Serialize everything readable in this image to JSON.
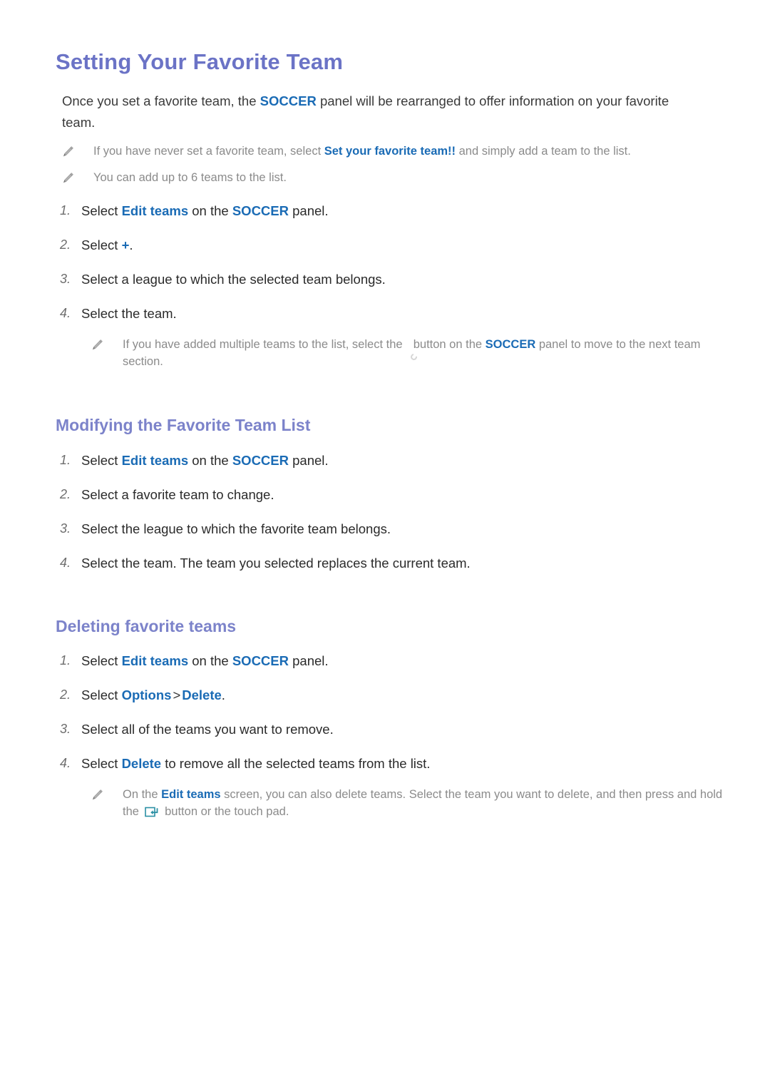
{
  "document": {
    "title": "Setting Your Favorite Team",
    "intro": {
      "before": "Once you set a favorite team, the ",
      "keyword": "SOCCER",
      "after": " panel will be rearranged to offer information on your favorite team."
    },
    "notes_top": [
      {
        "icon": "pencil-icon",
        "before": "If you have never set a favorite team, select ",
        "keyword": "Set your favorite team!!",
        "after": " and simply add a team to the list."
      },
      {
        "icon": "pencil-icon",
        "before": "You can add up to 6 teams to the list.",
        "keyword": "",
        "after": ""
      }
    ],
    "steps_setting": [
      {
        "num": "1.",
        "p1": "Select ",
        "k1": "Edit teams",
        "p2": " on the ",
        "k2": "SOCCER",
        "p3": " panel."
      },
      {
        "num": "2.",
        "p1": "Select ",
        "k1": "+",
        "p2": ".",
        "k2": "",
        "p3": ""
      },
      {
        "num": "3.",
        "p1": "Select a league to which the selected team belongs.",
        "k1": "",
        "p2": "",
        "k2": "",
        "p3": ""
      },
      {
        "num": "4.",
        "p1": "Select the team.",
        "k1": "",
        "p2": "",
        "k2": "",
        "p3": ""
      }
    ],
    "note_nested": {
      "icon": "pencil-icon",
      "before": "If you have added multiple teams to the list, select the ",
      "button_icon": "rotate-button-icon",
      "middle": " button on the ",
      "keyword": "SOCCER",
      "after": " panel to move to the next team section."
    },
    "section_modify": {
      "title": "Modifying the Favorite Team List",
      "steps": [
        {
          "num": "1.",
          "p1": "Select ",
          "k1": "Edit teams",
          "p2": " on the ",
          "k2": "SOCCER",
          "p3": " panel."
        },
        {
          "num": "2.",
          "p1": "Select a favorite team to change.",
          "k1": "",
          "p2": "",
          "k2": "",
          "p3": ""
        },
        {
          "num": "3.",
          "p1": "Select the league to which the favorite team belongs.",
          "k1": "",
          "p2": "",
          "k2": "",
          "p3": ""
        },
        {
          "num": "4.",
          "p1": "Select the team. The team you selected replaces the current team.",
          "k1": "",
          "p2": "",
          "k2": "",
          "p3": ""
        }
      ]
    },
    "section_delete": {
      "title": "Deleting favorite teams",
      "steps": [
        {
          "num": "1.",
          "p1": "Select ",
          "k1": "Edit teams",
          "p2": " on the ",
          "k2": "SOCCER",
          "p3": " panel."
        },
        {
          "num": "2.",
          "p1": "Select ",
          "k1": "Options",
          "sep": ">",
          "k2": "Delete",
          "p3": "."
        },
        {
          "num": "3.",
          "p1": "Select all of the teams you want to remove.",
          "k1": "",
          "p2": "",
          "k2": "",
          "p3": ""
        },
        {
          "num": "4.",
          "p1": "Select ",
          "k1": "Delete",
          "p2": " to remove all the selected teams from the list.",
          "k2": "",
          "p3": ""
        }
      ],
      "note": {
        "icon": "pencil-icon",
        "before": "On the ",
        "keyword": "Edit teams",
        "middle": " screen, you can also delete teams. Select the team you want to delete, and then press and hold the ",
        "button_icon": "enter-key-icon",
        "after": " button or the touch pad."
      }
    }
  },
  "colors": {
    "heading_purple": "#6b73c6",
    "keyword_blue": "#1a6bb5",
    "body_text": "#2b2b2b",
    "note_gray": "#8b8b8b",
    "number_gray": "#6e6e6e",
    "enter_icon_teal": "#2a8fa4",
    "rotate_button_dark": "#4c4c4c",
    "background": "#ffffff"
  }
}
